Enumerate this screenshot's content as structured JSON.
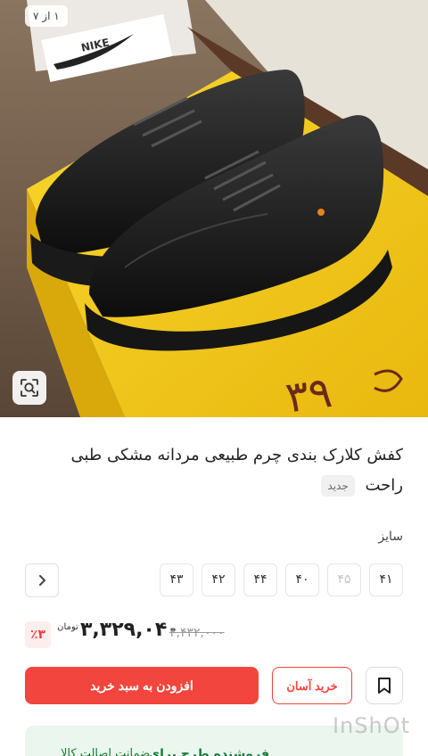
{
  "gallery": {
    "counter": "۱ از ۷",
    "box_text": "NIKE",
    "box_numbers": "۳۹",
    "lens_icon": "image-search-icon"
  },
  "product": {
    "title": "کفش کلارک بندی چرم طبیعی مردانه مشکی طبی راحت",
    "badge": "جدید",
    "size_label": "سایز",
    "sizes": [
      {
        "label": "۴۱",
        "available": true
      },
      {
        "label": "۴۵",
        "available": false
      },
      {
        "label": "۴۰",
        "available": true
      },
      {
        "label": "۴۴",
        "available": true
      },
      {
        "label": "۴۲",
        "available": true
      },
      {
        "label": "۴۳",
        "available": true
      }
    ]
  },
  "pricing": {
    "old_price": "۳,۴۳۲,۰۰۰",
    "price": "۳,۳۲۹,۰۴۰",
    "currency": "تومان",
    "discount": "٪۳"
  },
  "actions": {
    "add_to_cart": "افزودن به سبد خرید",
    "easy_buy": "خرید آسان"
  },
  "bottom": {
    "text": "فروشنده طرح برای",
    "link": "ضمانت اصالت کالا"
  },
  "watermark": "InShOt",
  "colors": {
    "accent": "#f2453d",
    "box_yellow": "#f4c81a",
    "green_bg": "#eaf6ee"
  }
}
